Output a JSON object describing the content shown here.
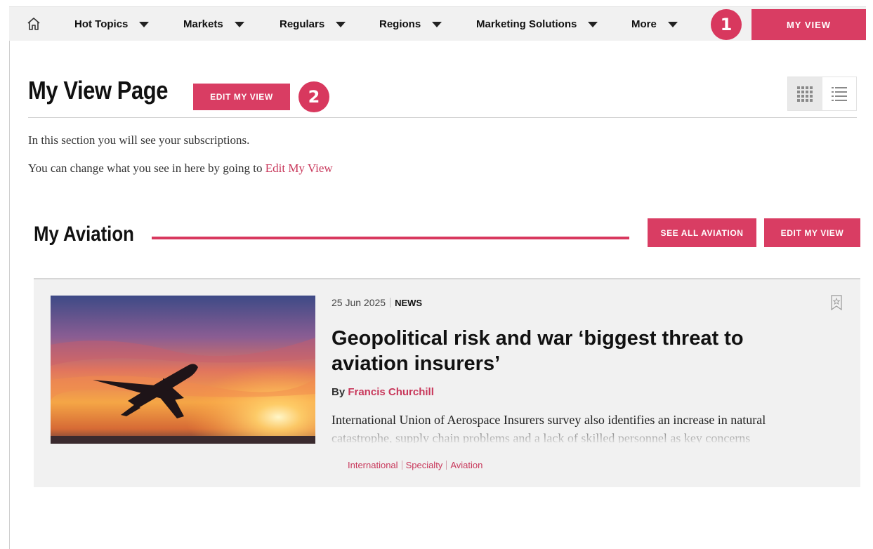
{
  "nav": {
    "items": [
      {
        "label": "Hot Topics"
      },
      {
        "label": "Markets"
      },
      {
        "label": "Regulars"
      },
      {
        "label": "Regions"
      },
      {
        "label": "Marketing Solutions"
      },
      {
        "label": "More"
      }
    ],
    "my_view_label": "MY VIEW",
    "badge_1": "1"
  },
  "page": {
    "title": "My View Page",
    "edit_button": "EDIT MY VIEW",
    "badge_2": "2",
    "intro_line1": "In this section you will see your subscriptions.",
    "intro_line2_prefix": "You can change what you see in here by going to ",
    "intro_link": "Edit My View"
  },
  "section": {
    "title": "My Aviation",
    "see_all_label": "SEE ALL AVIATION",
    "edit_label": "EDIT MY VIEW"
  },
  "article": {
    "date": "25 Jun 2025",
    "type": "NEWS",
    "headline": "Geopolitical risk and war ‘biggest threat to aviation insurers’",
    "by_prefix": "By ",
    "author": "Francis Churchill",
    "summary": "International Union of Aerospace Insurers survey also identifies an increase in natural catastrophe, supply chain problems and a lack of skilled personnel as key concerns",
    "tags": [
      "International",
      "Specialty",
      "Aviation"
    ]
  },
  "colors": {
    "accent": "#d93d63",
    "link": "#c8385b",
    "nav_bg": "#f1f1f1",
    "card_bg": "#f1f1f1"
  },
  "icons": {
    "home": "home-icon",
    "caret": "caret-down-icon",
    "grid_view": "grid-view-icon",
    "list_view": "list-view-icon",
    "bookmark": "bookmark-star-icon"
  }
}
